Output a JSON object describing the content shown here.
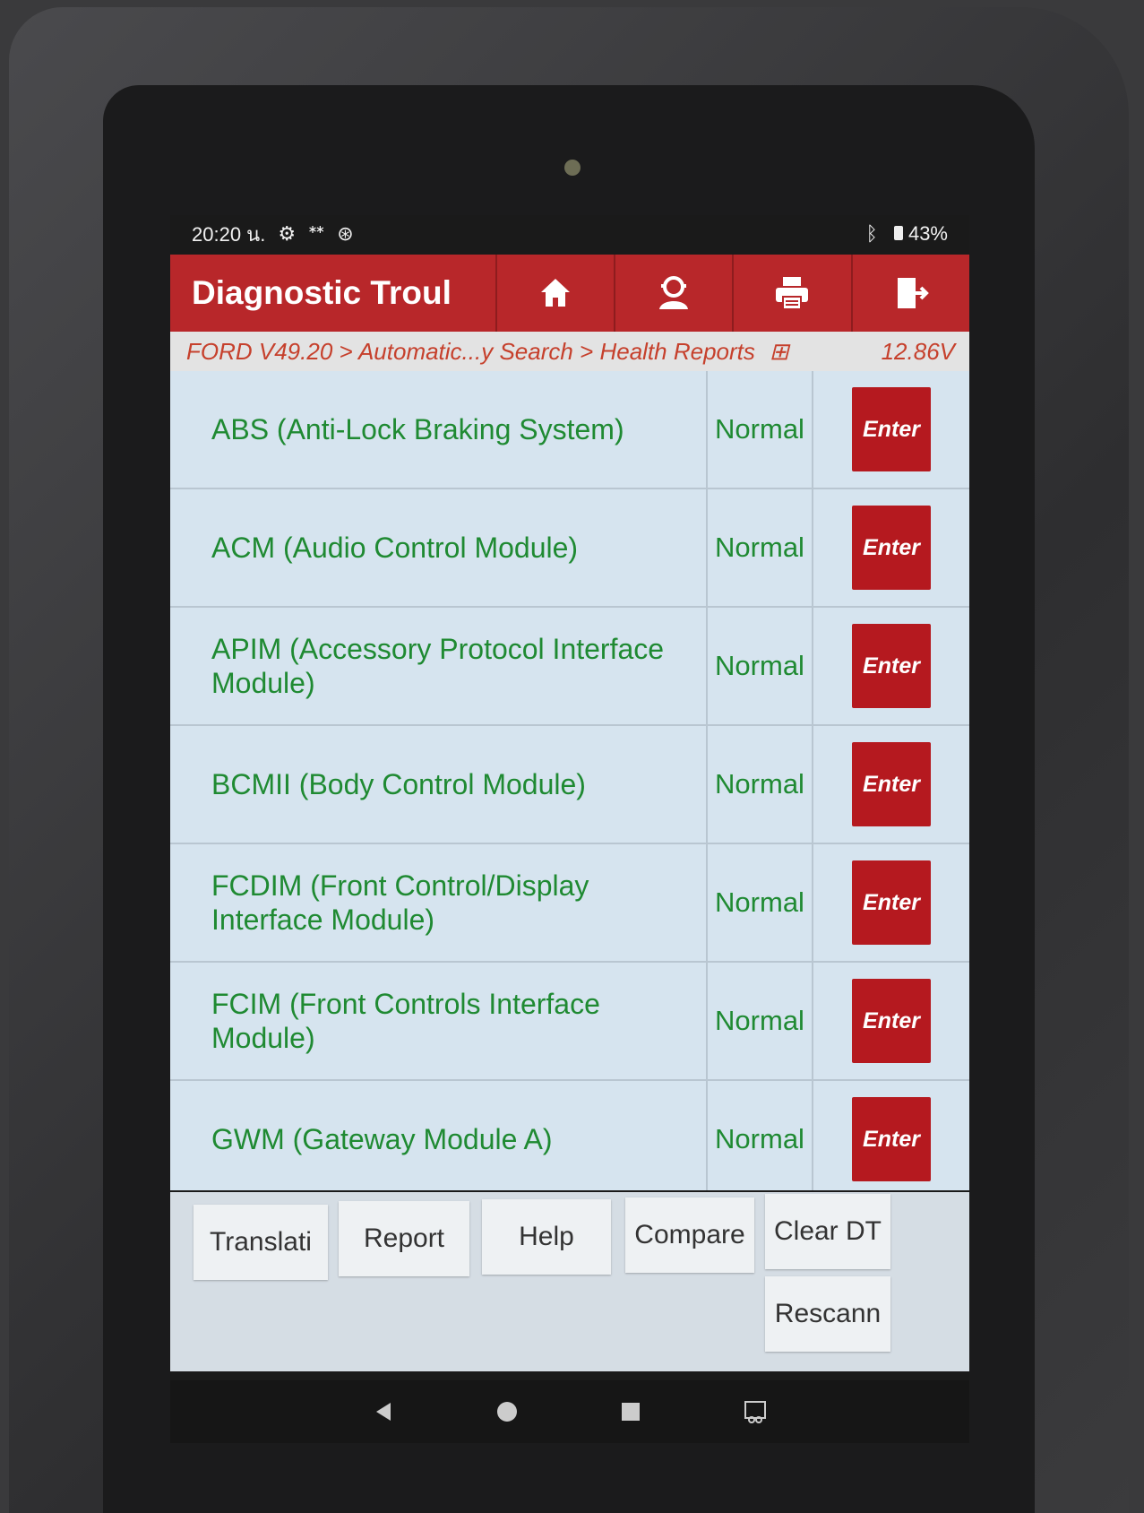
{
  "status_bar": {
    "time": "20:20 น.",
    "battery": "43%",
    "icons": [
      "settings-gear-icon",
      "usb-icon",
      "bluetooth-circle-icon",
      "bluetooth-icon",
      "battery-icon"
    ]
  },
  "app_bar": {
    "title": "Diagnostic Troul",
    "buttons": [
      "home-icon",
      "support-person-icon",
      "printer-icon",
      "exit-icon"
    ]
  },
  "breadcrumb": {
    "path": "FORD V49.20 > Automatic...y Search > Health Reports",
    "voltage": "12.86V"
  },
  "modules": [
    {
      "name": "ABS (Anti-Lock Braking System)",
      "status": "Normal",
      "action": "Enter"
    },
    {
      "name": "ACM (Audio Control Module)",
      "status": "Normal",
      "action": "Enter"
    },
    {
      "name": "APIM (Accessory Protocol Interface Module)",
      "status": "Normal",
      "action": "Enter"
    },
    {
      "name": "BCMII (Body Control Module)",
      "status": "Normal",
      "action": "Enter"
    },
    {
      "name": "FCDIM (Front Control/Display Interface Module)",
      "status": "Normal",
      "action": "Enter"
    },
    {
      "name": "FCIM (Front Controls Interface Module)",
      "status": "Normal",
      "action": "Enter"
    },
    {
      "name": "GWM (Gateway Module A)",
      "status": "Normal",
      "action": "Enter"
    }
  ],
  "toolbar": {
    "translate": "Translati",
    "report": "Report",
    "help": "Help",
    "compare": "Compare",
    "clear_dtc": "Clear DT",
    "rescan": "Rescann"
  },
  "colors": {
    "app_bar": "#b8272a",
    "enter_button": "#b5191f",
    "status_text": "#1f8a32",
    "breadcrumb_text": "#c6402c"
  }
}
